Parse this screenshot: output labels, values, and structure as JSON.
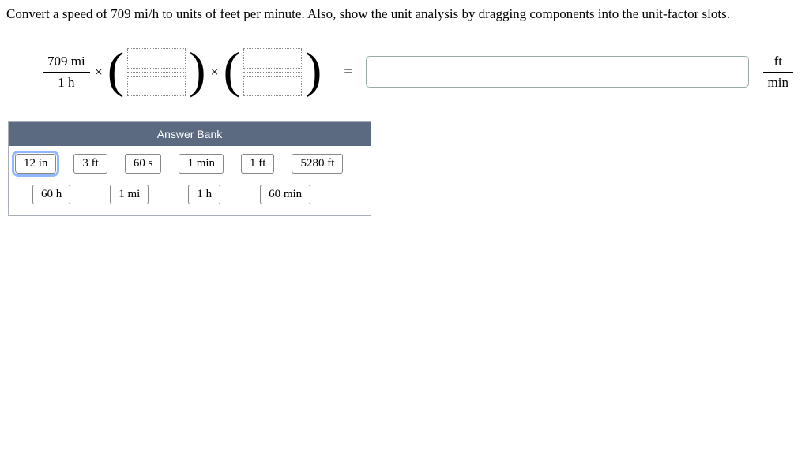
{
  "question": {
    "text": "Convert a speed of 709 mi/h to units of feet per minute. Also, show the unit analysis by dragging components into the unit-factor slots."
  },
  "expression": {
    "given": {
      "numerator": "709 mi",
      "denominator": "1 h"
    },
    "times": "×",
    "equals": "=",
    "result_unit": {
      "numerator": "ft",
      "denominator": "min"
    },
    "answer_value": ""
  },
  "bank": {
    "title": "Answer Bank",
    "row1": [
      "12 in",
      "3 ft",
      "60 s",
      "1 min",
      "1 ft",
      "5280 ft"
    ],
    "row2": [
      "60 h",
      "1 mi",
      "1 h",
      "60 min"
    ],
    "selected": "12 in"
  }
}
